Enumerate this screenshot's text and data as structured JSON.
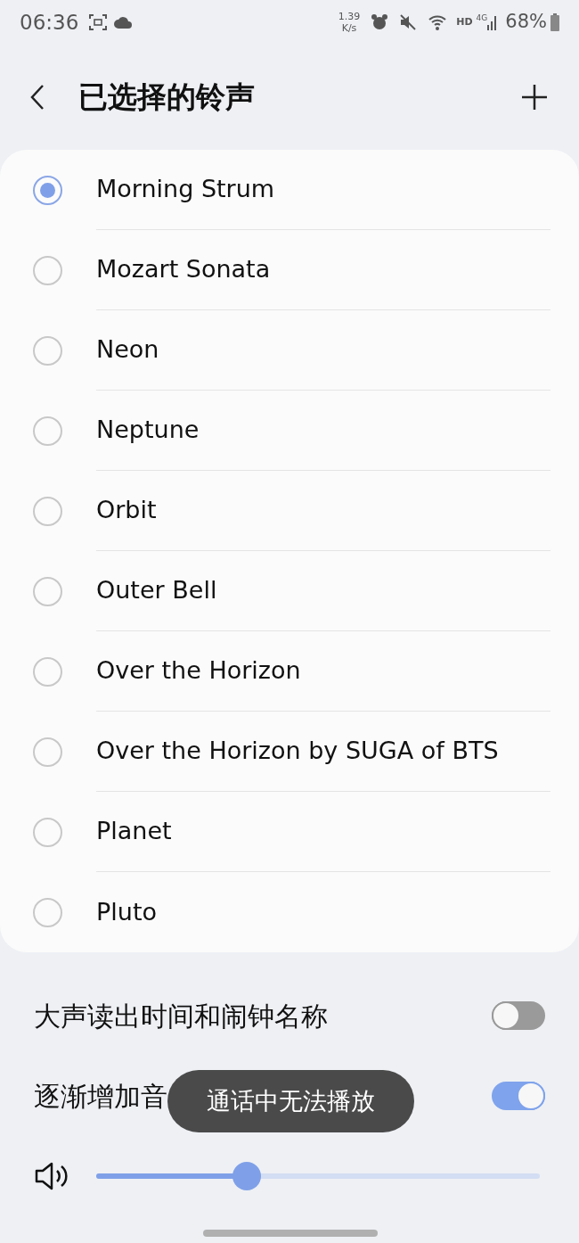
{
  "status_bar": {
    "time": "06:36",
    "speed_value": "1.39",
    "speed_unit": "K/s",
    "hd": "HD",
    "network": "4G",
    "battery": "68%"
  },
  "header": {
    "title": "已选择的铃声"
  },
  "ringtones": [
    {
      "name": "Morning Strum",
      "selected": true
    },
    {
      "name": "Mozart Sonata",
      "selected": false
    },
    {
      "name": "Neon",
      "selected": false
    },
    {
      "name": "Neptune",
      "selected": false
    },
    {
      "name": "Orbit",
      "selected": false
    },
    {
      "name": "Outer Bell",
      "selected": false
    },
    {
      "name": "Over the Horizon",
      "selected": false
    },
    {
      "name": "Over the Horizon by SUGA of BTS",
      "selected": false
    },
    {
      "name": "Planet",
      "selected": false
    },
    {
      "name": "Pluto",
      "selected": false
    }
  ],
  "settings": [
    {
      "label": "大声读出时间和闹钟名称",
      "on": false
    },
    {
      "label": "逐渐增加音",
      "on": true
    }
  ],
  "volume": {
    "level": 0.34
  },
  "toast": "通话中无法播放"
}
